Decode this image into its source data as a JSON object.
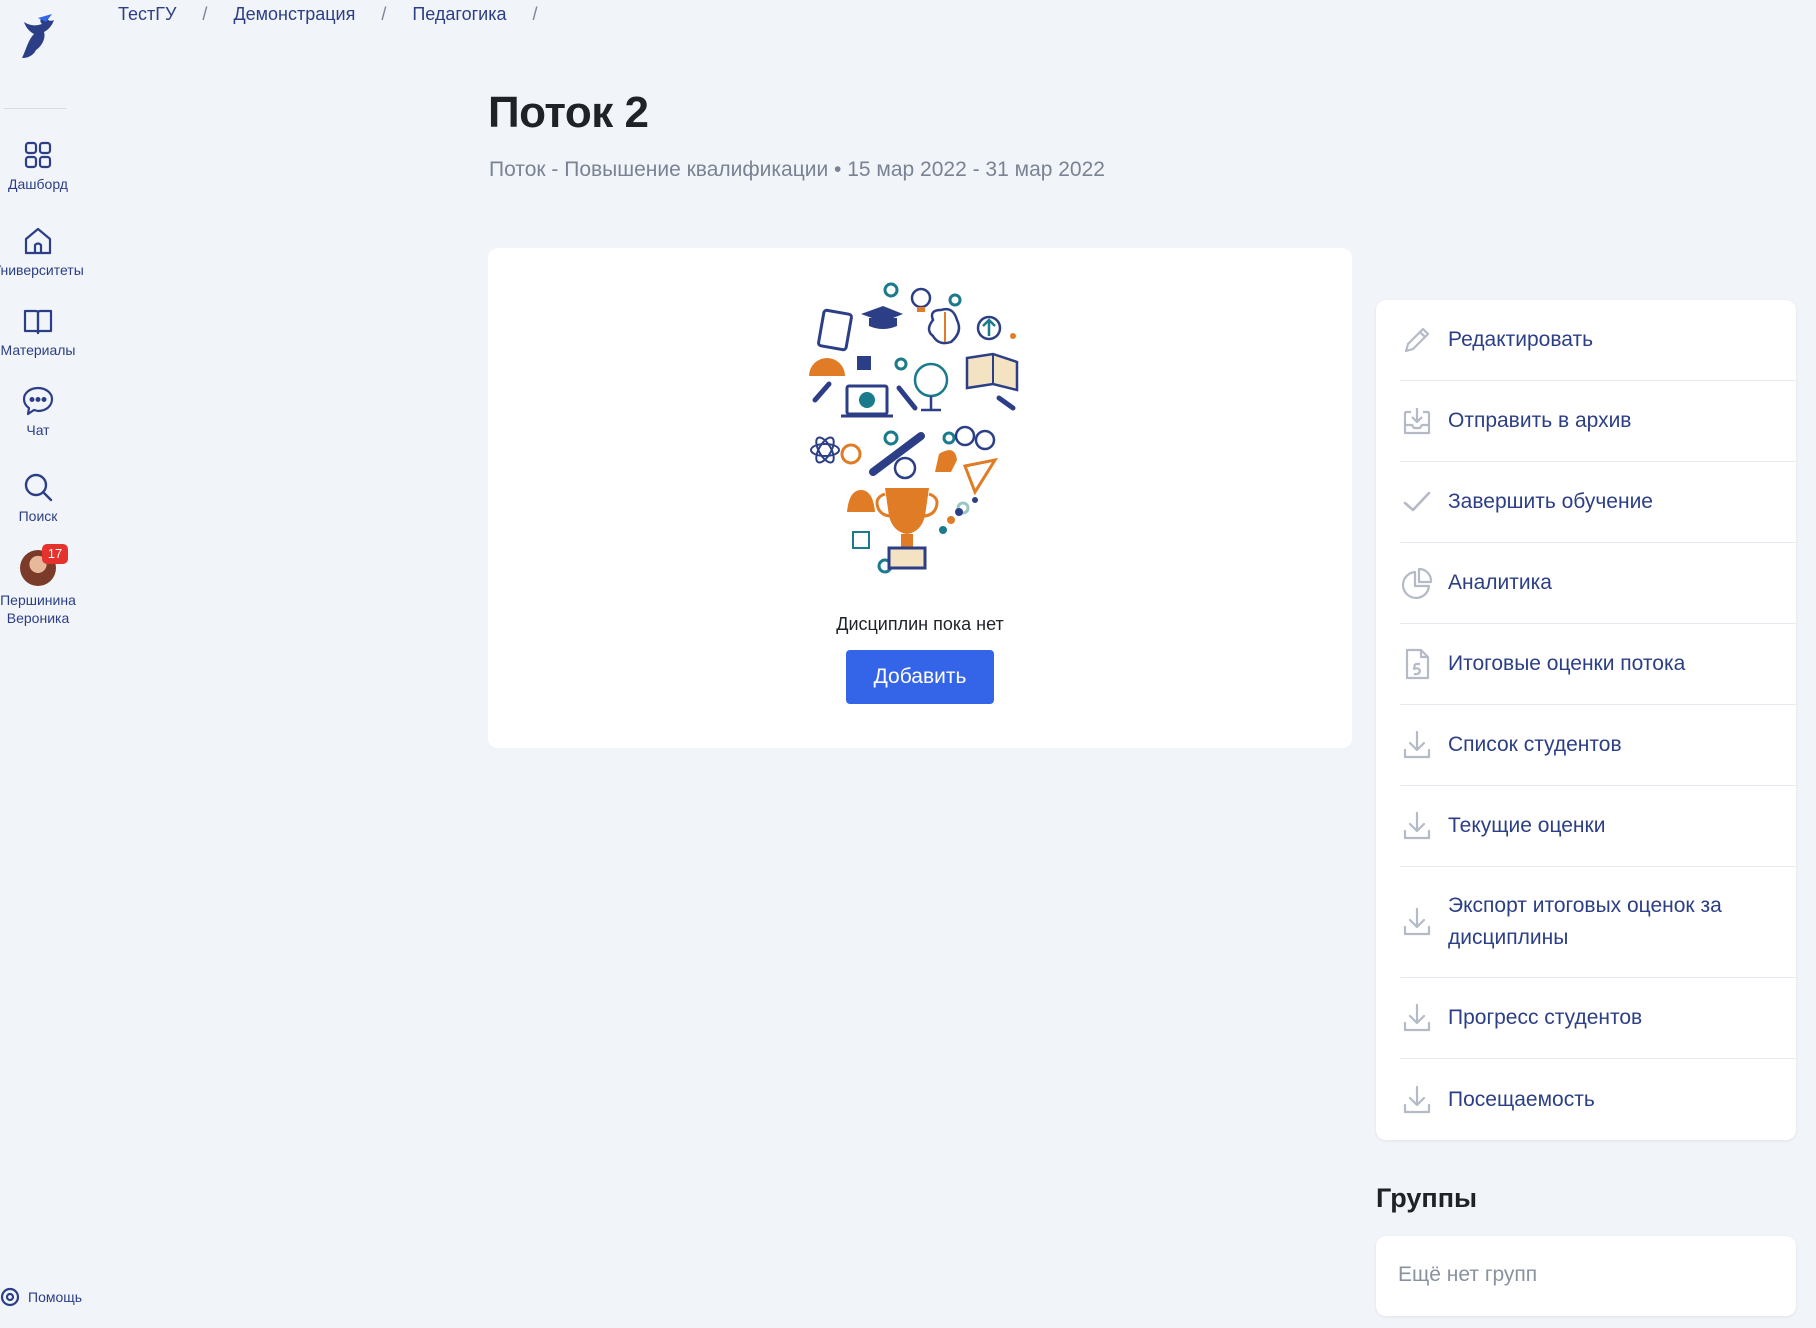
{
  "sidebar": {
    "items": [
      {
        "label": "Дашборд",
        "icon": "grid-icon"
      },
      {
        "label": "Университеты",
        "icon": "house-icon"
      },
      {
        "label": "Материалы",
        "icon": "book-icon"
      },
      {
        "label": "Чат",
        "icon": "chat-icon"
      },
      {
        "label": "Поиск",
        "icon": "search-icon"
      }
    ],
    "user": {
      "name": "Першинина Вероника",
      "badge": "17"
    },
    "help": "Помощь"
  },
  "breadcrumb": {
    "items": [
      "ТестГУ",
      "Демонстрация",
      "Педагогика"
    ],
    "separator": "/"
  },
  "header": {
    "title": "Поток 2",
    "subtitle": "Поток - Повышение квалификации • 15 мар 2022 - 31 мар 2022"
  },
  "disciplines": {
    "empty_text": "Дисциплин пока нет",
    "add_label": "Добавить"
  },
  "actions": [
    {
      "label": "Редактировать",
      "icon": "pencil-icon"
    },
    {
      "label": "Отправить в архив",
      "icon": "archive-icon"
    },
    {
      "label": "Завершить обучение",
      "icon": "check-icon"
    },
    {
      "label": "Аналитика",
      "icon": "pie-chart-icon"
    },
    {
      "label": "Итоговые оценки потока",
      "icon": "grade-file-icon"
    },
    {
      "label": "Список студентов",
      "icon": "download-icon"
    },
    {
      "label": "Текущие оценки",
      "icon": "download-icon"
    },
    {
      "label": "Экспорт итоговых оценок за дисциплины",
      "icon": "download-icon"
    },
    {
      "label": "Прогресс студентов",
      "icon": "download-icon"
    },
    {
      "label": "Посещаемость",
      "icon": "download-icon"
    }
  ],
  "groups": {
    "title": "Группы",
    "empty_text": "Ещё нет групп"
  },
  "colors": {
    "accent": "#3464e8",
    "link": "#2c3f86",
    "muted": "#7a8394",
    "background": "#f1f4f8",
    "badge": "#e5322d"
  }
}
